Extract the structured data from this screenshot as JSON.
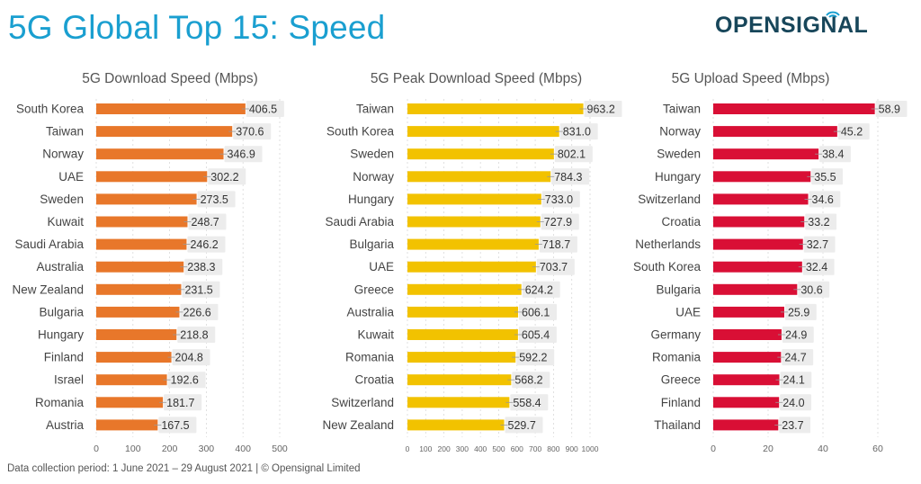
{
  "header": {
    "title": "5G Global Top 15: Speed",
    "brand": "OPENSIGNAL"
  },
  "footer": {
    "text": "Data collection period: 1 June 2021 – 29 August 2021  |  © Opensignal Limited"
  },
  "colors": {
    "title": "#1a9fd0",
    "brand": "#17465a",
    "download_bar": "#e8772a",
    "peak_bar": "#f2c200",
    "upload_bar": "#d90f35",
    "value_box": "#ececec"
  },
  "chart_data": [
    {
      "type": "bar",
      "orientation": "horizontal",
      "title": "5G Download Speed (Mbps)",
      "xlabel": "",
      "ylabel": "",
      "xlim": [
        0,
        500
      ],
      "ticks": [
        0,
        100,
        200,
        300,
        400,
        500
      ],
      "grid": true,
      "color_key": "download_bar",
      "categories": [
        "South Korea",
        "Taiwan",
        "Norway",
        "UAE",
        "Sweden",
        "Kuwait",
        "Saudi Arabia",
        "Australia",
        "New Zealand",
        "Bulgaria",
        "Hungary",
        "Finland",
        "Israel",
        "Romania",
        "Austria"
      ],
      "values": [
        406.5,
        370.6,
        346.9,
        302.2,
        273.5,
        248.7,
        246.2,
        238.3,
        231.5,
        226.6,
        218.8,
        204.8,
        192.6,
        181.7,
        167.5
      ],
      "value_labels": [
        "406.5",
        "370.6",
        "346.9",
        "302.2",
        "273.5",
        "248.7",
        "246.2",
        "238.3",
        "231.5",
        "226.6",
        "218.8",
        "204.8",
        "192.6",
        "181.7",
        "167.5"
      ]
    },
    {
      "type": "bar",
      "orientation": "horizontal",
      "title": "5G Peak Download Speed (Mbps)",
      "xlabel": "",
      "ylabel": "",
      "xlim": [
        0,
        1000
      ],
      "ticks": [
        0,
        100,
        200,
        300,
        400,
        500,
        600,
        700,
        800,
        900,
        1000
      ],
      "grid": true,
      "color_key": "peak_bar",
      "categories": [
        "Taiwan",
        "South Korea",
        "Sweden",
        "Norway",
        "Hungary",
        "Saudi Arabia",
        "Bulgaria",
        "UAE",
        "Greece",
        "Australia",
        "Kuwait",
        "Romania",
        "Croatia",
        "Switzerland",
        "New Zealand"
      ],
      "values": [
        963.2,
        831.0,
        802.1,
        784.3,
        733.0,
        727.9,
        718.7,
        703.7,
        624.2,
        606.1,
        605.4,
        592.2,
        568.2,
        558.4,
        529.7
      ],
      "value_labels": [
        "963.2",
        "831.0",
        "802.1",
        "784.3",
        "733.0",
        "727.9",
        "718.7",
        "703.7",
        "624.2",
        "606.1",
        "605.4",
        "592.2",
        "568.2",
        "558.4",
        "529.7"
      ]
    },
    {
      "type": "bar",
      "orientation": "horizontal",
      "title": "5G Upload Speed (Mbps)",
      "xlabel": "",
      "ylabel": "",
      "xlim": [
        0,
        60
      ],
      "ticks": [
        0,
        20,
        40,
        60
      ],
      "grid": true,
      "color_key": "upload_bar",
      "categories": [
        "Taiwan",
        "Norway",
        "Sweden",
        "Hungary",
        "Switzerland",
        "Croatia",
        "Netherlands",
        "South Korea",
        "Bulgaria",
        "UAE",
        "Germany",
        "Romania",
        "Greece",
        "Finland",
        "Thailand"
      ],
      "values": [
        58.9,
        45.2,
        38.4,
        35.5,
        34.6,
        33.2,
        32.7,
        32.4,
        30.6,
        25.9,
        24.9,
        24.7,
        24.1,
        24.0,
        23.7
      ],
      "value_labels": [
        "58.9",
        "45.2",
        "38.4",
        "35.5",
        "34.6",
        "33.2",
        "32.7",
        "32.4",
        "30.6",
        "25.9",
        "24.9",
        "24.7",
        "24.1",
        "24.0",
        "23.7"
      ]
    }
  ]
}
